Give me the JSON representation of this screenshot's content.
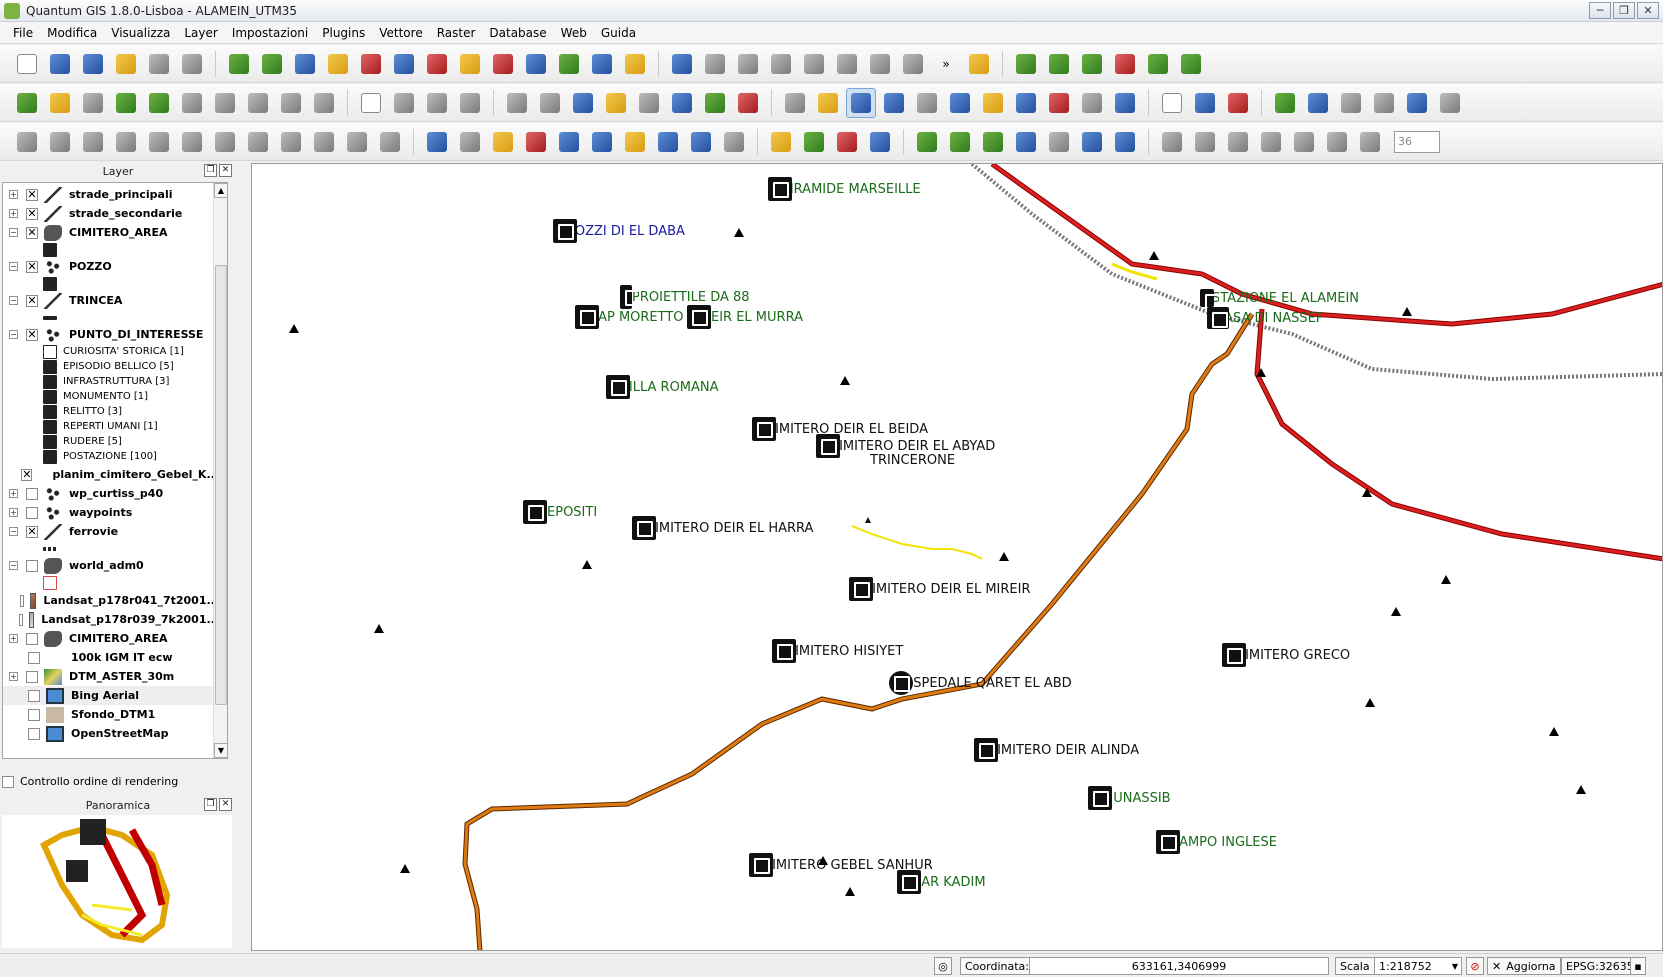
{
  "window": {
    "title": "Quantum GIS 1.8.0-Lisboa - ALAMEIN_UTM35",
    "controls": {
      "minimize": "─",
      "restore": "❐",
      "close": "✕"
    }
  },
  "menubar": [
    "File",
    "Modifica",
    "Visualizza",
    "Layer",
    "Impostazioni",
    "Plugins",
    "Vettore",
    "Raster",
    "Database",
    "Web",
    "Guida"
  ],
  "toolbar": {
    "more_label": "»",
    "spin_value": "36"
  },
  "layers_panel": {
    "title": "Layer",
    "float_btn": "❐",
    "close_btn": "✕",
    "scroll_up": "▲",
    "scroll_down": "▼",
    "layers": [
      {
        "name": "strade_principali",
        "checked": true,
        "icon": "line"
      },
      {
        "name": "strade_secondarie",
        "checked": true,
        "icon": "line"
      },
      {
        "name": "CIMITERO_AREA",
        "checked": true,
        "icon": "poly"
      },
      {
        "name": "POZZO",
        "checked": true,
        "icon": "points"
      },
      {
        "name": "TRINCEA",
        "checked": true,
        "icon": "line"
      },
      {
        "name": "PUNTO_DI_INTERESSE",
        "checked": true,
        "icon": "points"
      },
      {
        "name": "planim_cimitero_Gebel_K...",
        "checked": true,
        "icon": "none"
      },
      {
        "name": "wp_curtiss_p40",
        "checked": false,
        "icon": "points"
      },
      {
        "name": "waypoints",
        "checked": false,
        "icon": "points"
      },
      {
        "name": "ferrovie",
        "checked": true,
        "icon": "line"
      },
      {
        "name": "world_adm0",
        "checked": false,
        "icon": "poly"
      },
      {
        "name": "Landsat_p178r041_7t2001...",
        "checked": false,
        "icon": "raster"
      },
      {
        "name": "Landsat_p178r039_7k2001...",
        "checked": false,
        "icon": "raster2"
      },
      {
        "name": "CIMITERO_AREA",
        "checked": false,
        "icon": "poly"
      },
      {
        "name": "100k IGM IT ecw",
        "checked": false,
        "icon": "none"
      },
      {
        "name": "DTM_ASTER_30m",
        "checked": false,
        "icon": "dtm"
      },
      {
        "name": "Bing Aerial",
        "checked": false,
        "icon": "web"
      },
      {
        "name": "Sfondo_DTM1",
        "checked": false,
        "icon": "sfondo"
      },
      {
        "name": "OpenStreetMap",
        "checked": false,
        "icon": "web"
      }
    ],
    "categories": [
      "CURIOSITA' STORICA [1]",
      "EPISODIO BELLICO [5]",
      "INFRASTRUTTURA [3]",
      "MONUMENTO [1]",
      "RELITTO [3]",
      "REPERTI UMANI [1]",
      "RUDERE [5]",
      "POSTAZIONE [100]"
    ],
    "render_order_label": "Controllo ordine di rendering"
  },
  "overview_panel": {
    "title": "Panoramica",
    "float_btn": "❐",
    "close_btn": "✕"
  },
  "map": {
    "pois": [
      {
        "label": "PIRAMIDE MARSEILLE",
        "color": "#1a6b1a"
      },
      {
        "label": "POZZI DI EL DABA",
        "color": "#1a1a9a"
      },
      {
        "label": "PROIETTILE DA 88",
        "color": "#1a6b1a"
      },
      {
        "label": "CAP MORETTO",
        "color": "#1a6b1a"
      },
      {
        "label": "DEIR EL MURRA",
        "color": "#1a6b1a"
      },
      {
        "label": "VILLA ROMANA",
        "color": "#1a6b1a"
      },
      {
        "label": "CIMITERO DEIR EL BEIDA",
        "color": "#111111"
      },
      {
        "label": "CIMITERO DEIR EL ABYAD",
        "color": "#111111"
      },
      {
        "label": "TRINCERONE",
        "color": "#111111"
      },
      {
        "label": "DEPOSITI",
        "color": "#1a6b1a"
      },
      {
        "label": "CIMITERO DEIR EL HARRA",
        "color": "#111111"
      },
      {
        "label": "CIMITERO DEIR EL MIREIR",
        "color": "#111111"
      },
      {
        "label": "CIMITERO HISIYET",
        "color": "#111111"
      },
      {
        "label": "OSPEDALE QARET EL ABD",
        "color": "#111111"
      },
      {
        "label": "CIMITERO GRECO",
        "color": "#111111"
      },
      {
        "label": "CIMITERO DEIR ALINDA",
        "color": "#111111"
      },
      {
        "label": "MUNASSIB",
        "color": "#1a6b1a"
      },
      {
        "label": "CAMPO INGLESE",
        "color": "#1a6b1a"
      },
      {
        "label": "CIMITERO GEBEL SANHUR",
        "color": "#111111"
      },
      {
        "label": "QAR KADIM",
        "color": "#1a6b1a"
      },
      {
        "label": "STAZIONE EL ALAMEIN",
        "color": "#1a6b1a"
      },
      {
        "label": "CASA DI NASSEF",
        "color": "#1a6b1a"
      }
    ],
    "colors": {
      "main_road": "#d91f1f",
      "secondary_road": "#e07a12",
      "railway": "#777777",
      "trench": "#f0e400"
    }
  },
  "statusbar": {
    "coord_label": "Coordinata:",
    "coord_value": "633161,3406999",
    "scale_label": "Scala",
    "scale_value": "1:218752",
    "refresh_label": "Aggiorna",
    "crs": "EPSG:32635"
  }
}
